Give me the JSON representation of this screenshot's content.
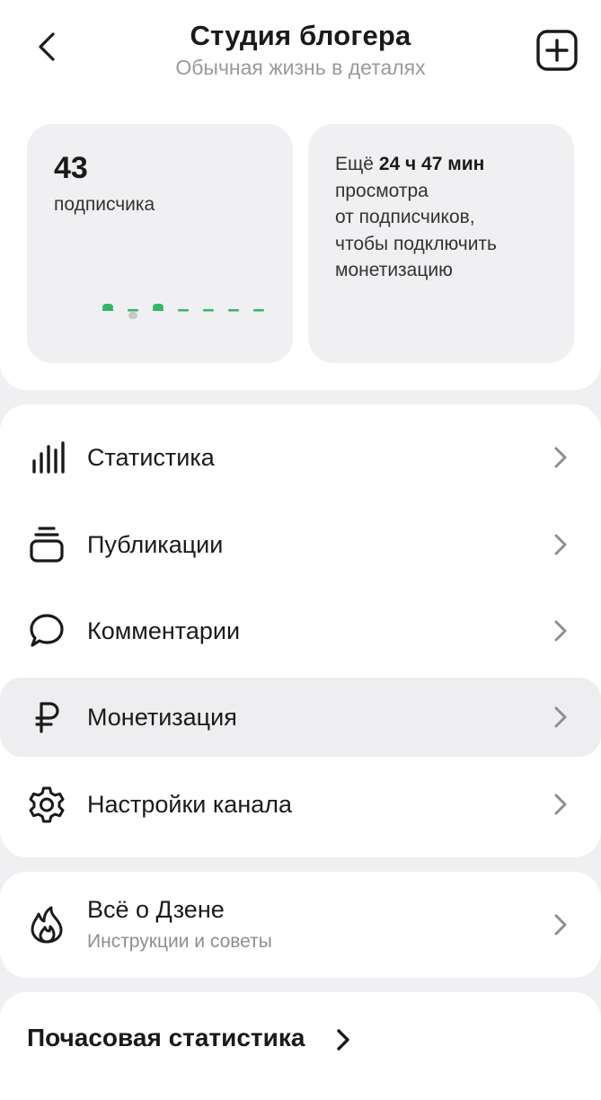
{
  "header": {
    "title": "Студия блогера",
    "subtitle": "Обычная жизнь в деталях"
  },
  "subscribers": {
    "count": "43",
    "label": "подписчика"
  },
  "monetization_progress": {
    "prefix": "Ещё",
    "time": "24 ч 47 мин",
    "line2": "просмотра",
    "line3": "от подписчиков,",
    "line4": "чтобы подключить",
    "line5": "монетизацию"
  },
  "menu": {
    "items": [
      {
        "label": "Статистика",
        "icon": "bar-chart-icon"
      },
      {
        "label": "Публикации",
        "icon": "stack-icon"
      },
      {
        "label": "Комментарии",
        "icon": "comment-icon"
      },
      {
        "label": "Монетизация",
        "icon": "ruble-icon"
      },
      {
        "label": "Настройки канала",
        "icon": "gear-icon"
      }
    ]
  },
  "dzen": {
    "title": "Всё о Дзене",
    "subtitle": "Инструкции и советы",
    "icon": "flame-icon"
  },
  "hourly": {
    "title": "Почасовая статистика"
  },
  "colors": {
    "accent_green": "#2fb866",
    "text_primary": "#1a1a1a",
    "text_secondary": "#9a9a9e",
    "card_bg": "#f0f0f2"
  }
}
